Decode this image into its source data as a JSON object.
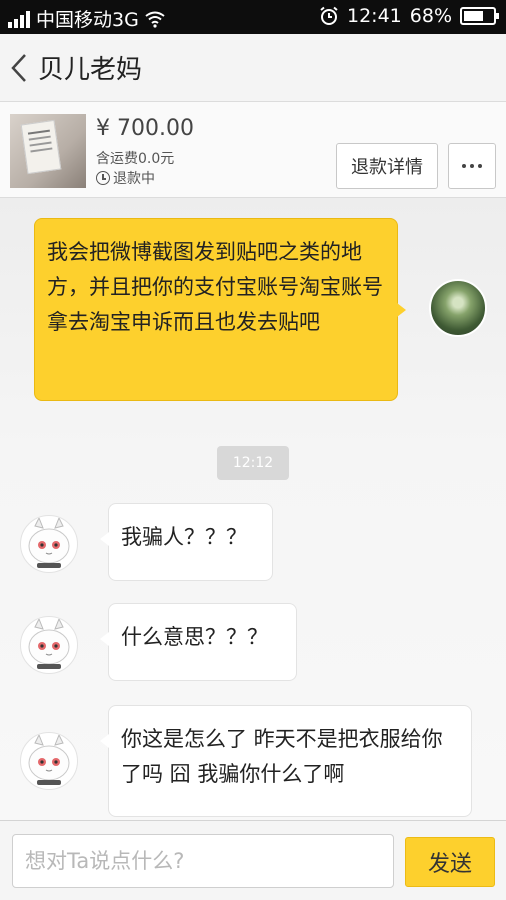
{
  "status_bar": {
    "carrier": "中国移动3G",
    "time": "12:41",
    "battery": "68%",
    "battery_level": 0.68
  },
  "header": {
    "title": "贝儿老妈"
  },
  "order": {
    "price": "¥ 700.00",
    "shipping": "含运费0.0元",
    "status": "退款中",
    "refund_details_label": "退款详情",
    "more_label": "..."
  },
  "messages": [
    {
      "side": "me",
      "text": "我会把微博截图发到贴吧之类的地方，并且把你的支付宝账号淘宝账号拿去淘宝申诉而且也发去贴吧"
    },
    {
      "side": "other",
      "text": "我骗人？？？"
    },
    {
      "side": "other",
      "text": "什么意思？？？"
    },
    {
      "side": "other",
      "text": "你这是怎么了 昨天不是把衣服给你了吗 囧 我骗你什么了啊"
    }
  ],
  "timestamp": "12:12",
  "input": {
    "placeholder": "想对Ta说点什么?",
    "send_label": "发送"
  },
  "colors": {
    "accent": "#fdd02d",
    "status_bar": "#0d0d0d"
  },
  "icons": [
    "signal-icon",
    "wifi-icon",
    "alarm-icon",
    "battery-icon",
    "back-icon",
    "clock-icon",
    "more-icon"
  ]
}
